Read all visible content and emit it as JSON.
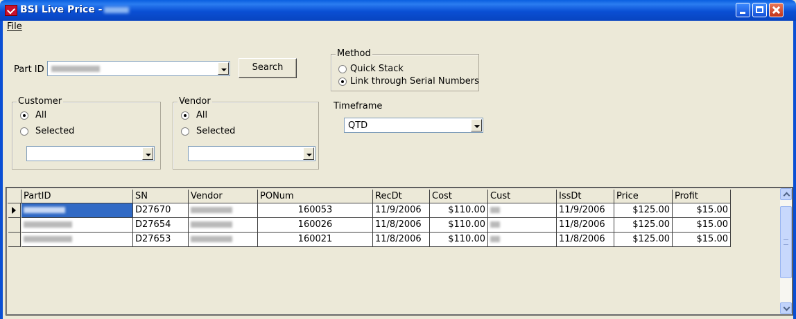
{
  "window": {
    "title": "BSI Live Price -"
  },
  "menu": {
    "file": "File"
  },
  "search": {
    "part_id_label": "Part ID",
    "button_label": "Search"
  },
  "method": {
    "legend": "Method",
    "option_quick": "Quick Stack",
    "option_serial": "Link through Serial Numbers",
    "selected": "Link through Serial Numbers"
  },
  "customer": {
    "legend": "Customer",
    "option_all": "All",
    "option_selected": "Selected",
    "selected": "All"
  },
  "vendor": {
    "legend": "Vendor",
    "option_all": "All",
    "option_selected": "Selected",
    "selected": "All"
  },
  "timeframe": {
    "label": "Timeframe",
    "value": "QTD"
  },
  "grid": {
    "columns": [
      "PartID",
      "SN",
      "Vendor",
      "PONum",
      "RecDt",
      "Cost",
      "Cust",
      "IssDt",
      "Price",
      "Profit"
    ],
    "rows": [
      {
        "sn": "D27670",
        "ponum": "160053",
        "recdt": "11/9/2006",
        "cost": "$110.00",
        "issdt": "11/9/2006",
        "price": "$125.00",
        "profit": "$15.00"
      },
      {
        "sn": "D27654",
        "ponum": "160026",
        "recdt": "11/8/2006",
        "cost": "$110.00",
        "issdt": "11/8/2006",
        "price": "$125.00",
        "profit": "$15.00"
      },
      {
        "sn": "D27653",
        "ponum": "160021",
        "recdt": "11/8/2006",
        "cost": "$110.00",
        "issdt": "11/8/2006",
        "price": "$125.00",
        "profit": "$15.00"
      }
    ]
  },
  "colors": {
    "titlebar": "#0a4fd4",
    "selection": "#316ac5",
    "face": "#ece9d8"
  }
}
